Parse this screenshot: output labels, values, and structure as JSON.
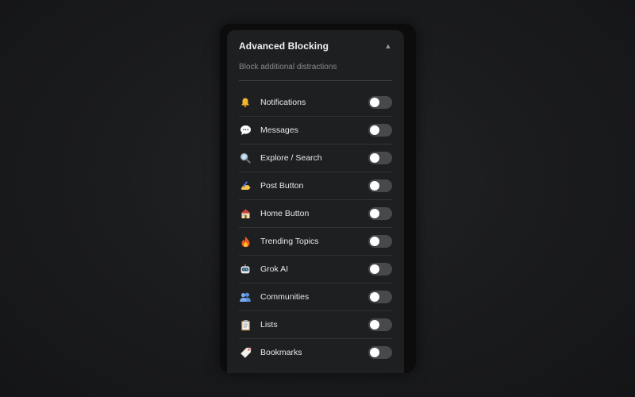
{
  "panel": {
    "title": "Advanced Blocking",
    "subtitle": "Block additional distractions",
    "collapse_glyph": "▲"
  },
  "items": [
    {
      "label": "Notifications",
      "icon": "bell-icon",
      "enabled": false
    },
    {
      "label": "Messages",
      "icon": "speech-bubble-icon",
      "enabled": false
    },
    {
      "label": "Explore / Search",
      "icon": "magnifier-icon",
      "enabled": false
    },
    {
      "label": "Post Button",
      "icon": "writing-hand-icon",
      "enabled": false
    },
    {
      "label": "Home Button",
      "icon": "house-icon",
      "enabled": false
    },
    {
      "label": "Trending Topics",
      "icon": "fire-icon",
      "enabled": false
    },
    {
      "label": "Grok AI",
      "icon": "robot-icon",
      "enabled": false
    },
    {
      "label": "Communities",
      "icon": "people-icon",
      "enabled": false
    },
    {
      "label": "Lists",
      "icon": "clipboard-icon",
      "enabled": false
    },
    {
      "label": "Bookmarks",
      "icon": "bookmark-tag-icon",
      "enabled": false
    }
  ],
  "colors": {
    "background": "#1b1c1e",
    "panel": "#1e1f21",
    "toggle_off": "#48494d",
    "knob": "#ffffff",
    "text": "#e8e8ea",
    "subtext": "#8a8b90"
  }
}
